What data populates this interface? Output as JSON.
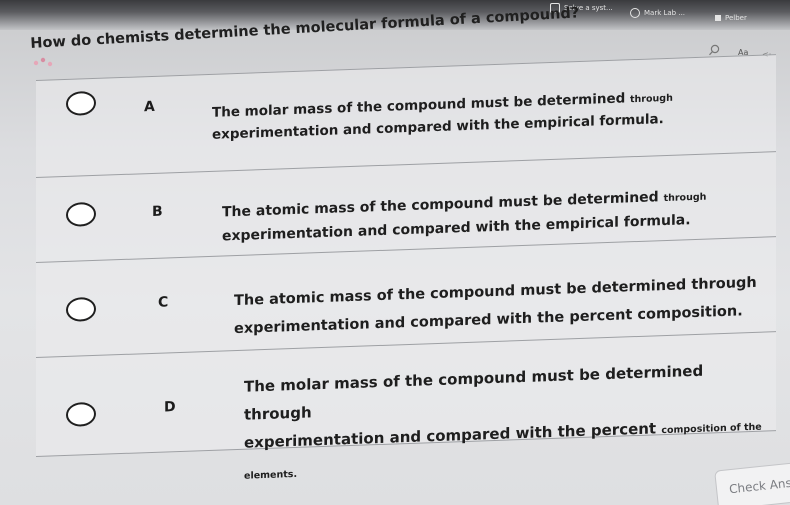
{
  "toolbar": {
    "item1": "Solve a syst...",
    "item2": "Mark Lab ...",
    "item3": "Pelber"
  },
  "reader": {
    "text_size_label": "Aa",
    "scroll_glyph": "<·"
  },
  "question": {
    "text": "How do chemists determine the molecular formula of a compound?"
  },
  "options": [
    {
      "letter": "A",
      "line1_main": "The molar mass of the compound must be determined ",
      "line1_small": "through",
      "line2": "experimentation and compared with the empirical formula."
    },
    {
      "letter": "B",
      "line1_main": "The atomic mass of the compound must be determined ",
      "line1_small": "through",
      "line2": "experimentation and compared with the empirical formula."
    },
    {
      "letter": "C",
      "line1_main": "The atomic mass of the compound must be determined through",
      "line1_small": "",
      "line2": "experimentation and compared with the percent composition."
    },
    {
      "letter": "D",
      "line1_main": "The molar mass of the compound must be determined through",
      "line1_small": "",
      "line2_main": "experimentation and compared with the percent ",
      "line2_small": "composition of the elements."
    }
  ],
  "check_answer": {
    "label": "Check Ans"
  }
}
